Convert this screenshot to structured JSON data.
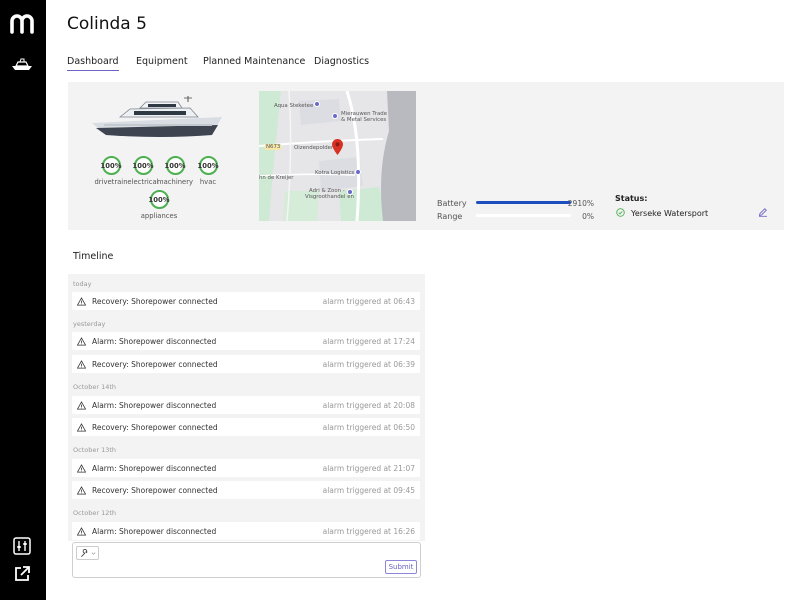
{
  "sidebar": {
    "logo_icon": "brand-m-logo",
    "items": [
      {
        "icon": "yacht-icon"
      },
      {
        "icon": "sliders-icon"
      },
      {
        "icon": "external-link-icon"
      }
    ]
  },
  "page": {
    "title": "Colinda 5"
  },
  "tabs": [
    {
      "label": "Dashboard",
      "active": true
    },
    {
      "label": "Equipment",
      "active": false
    },
    {
      "label": "Planned Maintenance",
      "active": false
    },
    {
      "label": "Diagnostics",
      "active": false
    }
  ],
  "systems": [
    {
      "value": "100%",
      "label": "drivetrain"
    },
    {
      "value": "100%",
      "label": "electrical"
    },
    {
      "value": "100%",
      "label": "machinery"
    },
    {
      "value": "100%",
      "label": "hvac"
    },
    {
      "value": "100%",
      "label": "appliances"
    }
  ],
  "map": {
    "labels": {
      "aqua": "Aqua Steketee",
      "mierauw": "Mierauwen Trade",
      "mierauw2": "& Metal Services",
      "road": "N673",
      "oizende": "Oizendepolder",
      "kotra": "Kotra Logistics",
      "kreijer": "hn de Kreijer",
      "adri": "Adri & Zoon -",
      "adri2": "Visgroothandel en"
    }
  },
  "meters": {
    "battery": {
      "label": "Battery",
      "value": "2910%",
      "fill": 1.0
    },
    "range": {
      "label": "Range",
      "value": "0%",
      "fill": 0.0
    }
  },
  "status": {
    "title": "Status:",
    "location": "Yerseke Watersport",
    "edit_icon": "pencil-icon"
  },
  "timeline": {
    "title": "Timeline",
    "groups": [
      {
        "label": "today",
        "entries": [
          {
            "text": "Recovery: Shorepower connected",
            "time": "alarm triggered at 06:43"
          }
        ]
      },
      {
        "label": "yesterday",
        "entries": [
          {
            "text": "Alarm: Shorepower disconnected",
            "time": "alarm triggered at 17:24"
          },
          {
            "text": "Recovery: Shorepower connected",
            "time": "alarm triggered at 06:39"
          }
        ]
      },
      {
        "label": "October 14th",
        "entries": [
          {
            "text": "Alarm: Shorepower disconnected",
            "time": "alarm triggered at 20:08"
          },
          {
            "text": "Recovery: Shorepower connected",
            "time": "alarm triggered at 06:50"
          }
        ]
      },
      {
        "label": "October 13th",
        "entries": [
          {
            "text": "Alarm: Shorepower disconnected",
            "time": "alarm triggered at 21:07"
          },
          {
            "text": "Recovery: Shorepower connected",
            "time": "alarm triggered at 09:45"
          }
        ]
      },
      {
        "label": "October 12th",
        "entries": [
          {
            "text": "Alarm: Shorepower disconnected",
            "time": "alarm triggered at 16:26"
          }
        ]
      }
    ]
  },
  "composer": {
    "placeholder": "",
    "submit_label": "Submit",
    "tool_icon": "wrench-icon"
  },
  "colors": {
    "accent": "#6a64c4",
    "battery": "#1f4fbf",
    "ok": "#4caf50",
    "sidebar": "#000000"
  }
}
